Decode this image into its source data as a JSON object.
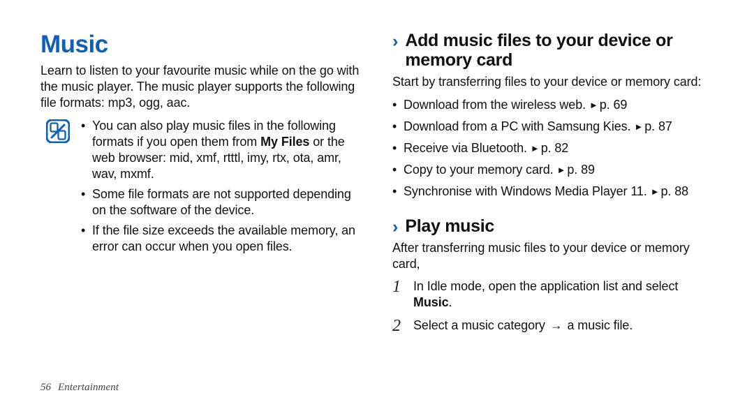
{
  "left": {
    "title": "Music",
    "intro": "Learn to listen to your favourite music while on the go with the music player. The music player supports the following file formats: mp3, ogg, aac.",
    "notes": {
      "item1_pre": "You can also play music files in the following formats if you open them from ",
      "item1_bold": "My Files",
      "item1_post": " or the web browser: mid, xmf, rtttl, imy, rtx, ota, amr, wav, mxmf.",
      "item2": "Some file formats are not supported depending on the software of the device.",
      "item3": "If the file size exceeds the available memory, an error can occur when you open files."
    }
  },
  "right": {
    "add": {
      "heading": "Add music files to your device or memory card",
      "lead": "Start by transferring files to your device or memory card:",
      "items": {
        "i1_text": "Download from the wireless web.",
        "i1_page": "p. 69",
        "i2_text": "Download from a PC with Samsung Kies.",
        "i2_page": "p. 87",
        "i3_text": "Receive via Bluetooth.",
        "i3_page": "p. 82",
        "i4_text": "Copy to your memory card.",
        "i4_page": "p. 89",
        "i5_text": "Synchronise with Windows Media Player 11.",
        "i5_page": "p. 88"
      }
    },
    "play": {
      "heading": "Play music",
      "lead": "After transferring music files to your device or memory card,",
      "steps": {
        "n1": "1",
        "s1_text": "In Idle mode, open the application list and select ",
        "s1_bold": "Music",
        "s1_post": ".",
        "n2": "2",
        "s2_pre": "Select a music category ",
        "s2_arrow": "→",
        "s2_post": " a music file."
      }
    }
  },
  "footer": {
    "page": "56",
    "section": "Entertainment"
  },
  "icons": {
    "chevron": "›",
    "triangle": "►",
    "arrow": "→"
  }
}
